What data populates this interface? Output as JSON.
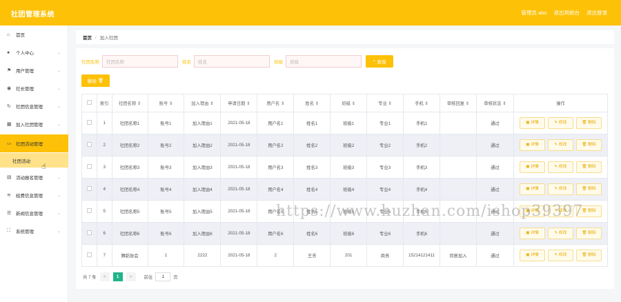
{
  "header": {
    "title": "社团管理系统",
    "admin": "管理员 abo",
    "back_label": "退出到前台",
    "logout_label": "退出登录"
  },
  "sidebar": {
    "items": [
      {
        "label": "首页",
        "icon": "home-icon"
      },
      {
        "label": "个人中心",
        "icon": "user-icon"
      },
      {
        "label": "用户管理",
        "icon": "flag-icon"
      },
      {
        "label": "社长管理",
        "icon": "location-icon"
      },
      {
        "label": "社团信息管理",
        "icon": "refresh-icon"
      },
      {
        "label": "加入社团管理",
        "icon": "grid-icon"
      },
      {
        "label": "社团活动管理",
        "icon": "screen-icon"
      },
      {
        "label": "活动报名管理",
        "icon": "table-icon"
      },
      {
        "label": "经费信息管理",
        "icon": "layers-icon"
      },
      {
        "label": "新闻信息管理",
        "icon": "bars-icon"
      },
      {
        "label": "系统管理",
        "icon": "expand-icon"
      }
    ],
    "sub_item": "社团活动"
  },
  "breadcrumb": {
    "home": "首页",
    "sep": "/",
    "current": "加入社团"
  },
  "search": {
    "club_label": "社团名称",
    "club_placeholder": "社团名称",
    "name_label": "姓名",
    "name_placeholder": "姓名",
    "class_label": "班级",
    "class_placeholder": "班级",
    "search_btn": "查询"
  },
  "toolbar": {
    "delete_label": "删除"
  },
  "table": {
    "headers": [
      "索引",
      "社团名称",
      "账号",
      "加入理由",
      "申请日期",
      "用户名",
      "姓名",
      "班级",
      "专业",
      "手机",
      "审核回复",
      "审核状态",
      "操作"
    ],
    "rows": [
      [
        "1",
        "社团名称1",
        "账号1",
        "加入理由1",
        "2021-05-18",
        "用户名1",
        "姓名1",
        "班级1",
        "专业1",
        "手机1",
        "",
        "通过"
      ],
      [
        "2",
        "社团名称2",
        "账号2",
        "加入理由2",
        "2021-05-18",
        "用户名2",
        "姓名2",
        "班级2",
        "专业2",
        "手机2",
        "",
        "通过"
      ],
      [
        "3",
        "社团名称3",
        "账号3",
        "加入理由3",
        "2021-05-18",
        "用户名3",
        "姓名3",
        "班级3",
        "专业3",
        "手机3",
        "",
        "通过"
      ],
      [
        "4",
        "社团名称4",
        "账号4",
        "加入理由4",
        "2021-05-18",
        "用户名4",
        "姓名4",
        "班级4",
        "专业4",
        "手机4",
        "",
        "通过"
      ],
      [
        "5",
        "社团名称5",
        "账号5",
        "加入理由5",
        "2021-05-18",
        "用户名5",
        "姓名5",
        "班级5",
        "专业5",
        "手机5",
        "",
        "通过"
      ],
      [
        "6",
        "社团名称6",
        "账号6",
        "加入理由6",
        "2021-05-18",
        "用户名6",
        "姓名6",
        "班级6",
        "专业6",
        "手机6",
        "",
        "通过"
      ],
      [
        "7",
        "舞蹈协会",
        "1",
        "2222",
        "2021-05-18",
        "2",
        "王芳",
        "201",
        "商务",
        "15214121411",
        "同意加入",
        "通过"
      ]
    ],
    "ops": {
      "detail": "详情",
      "edit": "修改",
      "delete": "删除"
    }
  },
  "pagination": {
    "total": "共 7 条",
    "prev": "<",
    "page": "1",
    "next": ">",
    "goto": "前往",
    "goto_value": "1",
    "page_suffix": "页"
  },
  "watermark": "https://www.huzhan.com/ishop39397"
}
